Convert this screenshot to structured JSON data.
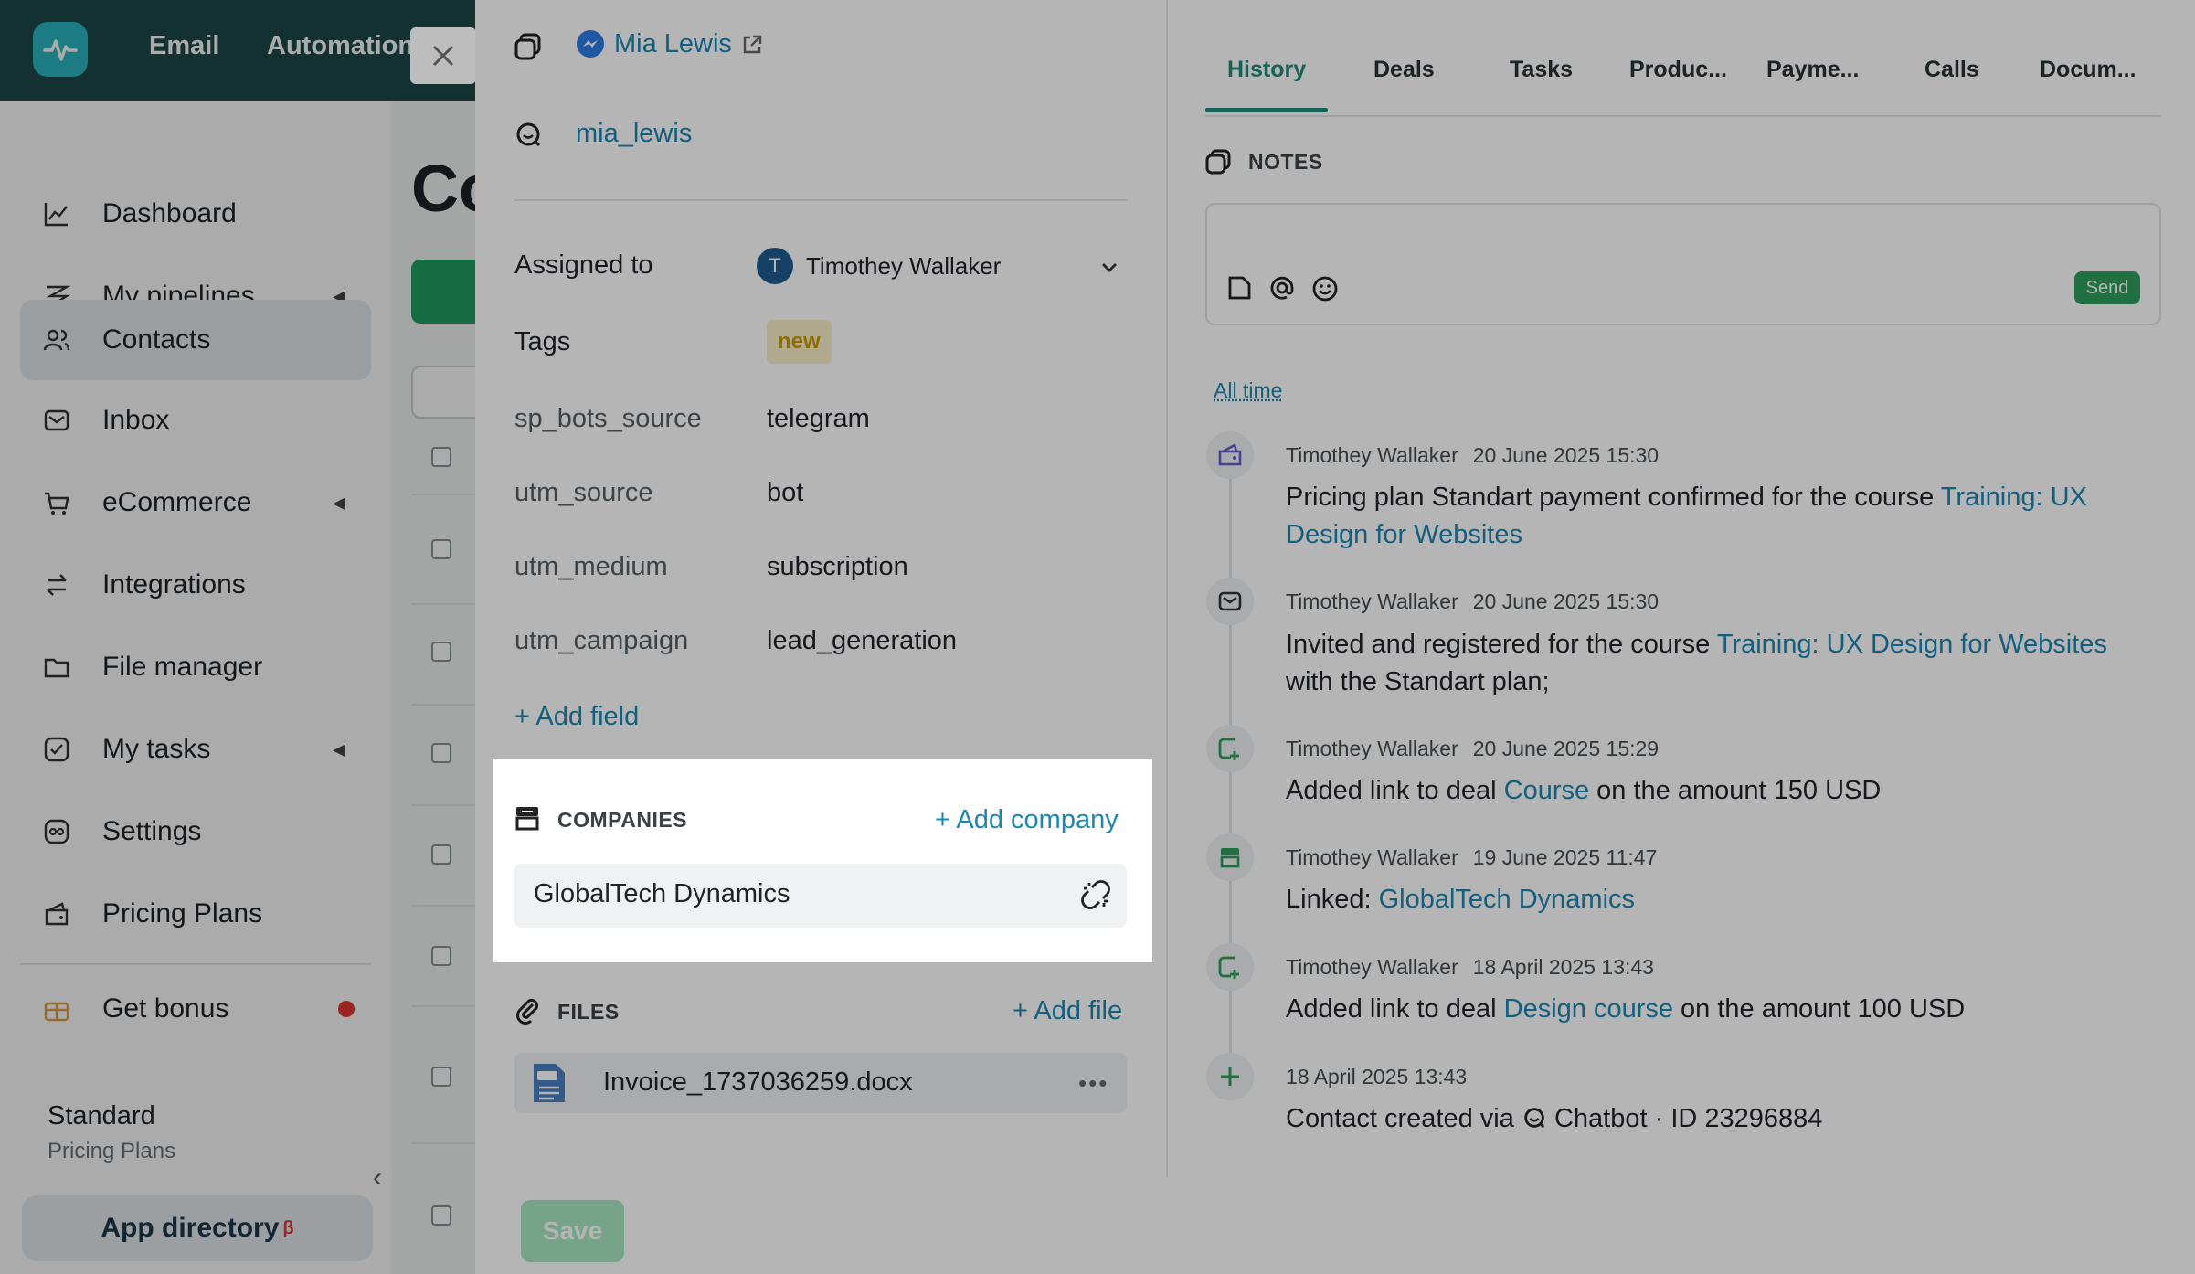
{
  "topbar": {
    "nav": [
      "Email",
      "Automation"
    ]
  },
  "sidebar": {
    "items": [
      {
        "label": "Dashboard",
        "icon": "chart-line-icon",
        "caret": false
      },
      {
        "label": "My pipelines",
        "icon": "pipelines-icon",
        "caret": true
      },
      {
        "label": "Contacts",
        "icon": "contacts-icon",
        "caret": false,
        "active": true
      },
      {
        "label": "Inbox",
        "icon": "inbox-icon",
        "caret": false
      },
      {
        "label": "eCommerce",
        "icon": "cart-icon",
        "caret": true
      },
      {
        "label": "Integrations",
        "icon": "arrows-icon",
        "caret": false
      },
      {
        "label": "File manager",
        "icon": "folder-icon",
        "caret": false
      },
      {
        "label": "My tasks",
        "icon": "check-icon",
        "caret": true
      },
      {
        "label": "Settings",
        "icon": "settings-icon",
        "caret": false
      },
      {
        "label": "Pricing Plans",
        "icon": "wallet-icon",
        "caret": false
      }
    ],
    "bonus_label": "Get bonus",
    "plan_name": "Standard",
    "plan_sub": "Pricing Plans",
    "app_directory": "App directory",
    "app_directory_badge": "β"
  },
  "main": {
    "title_fragment": "Co"
  },
  "contact": {
    "messenger_name": "Mia Lewis",
    "chatbot_username": "mia_lewis"
  },
  "fields": {
    "assigned_label": "Assigned to",
    "assigned_initial": "T",
    "assigned_name": "Timothey Wallaker",
    "tags_label": "Tags",
    "tag": "new",
    "custom": [
      {
        "label": "sp_bots_source",
        "value": "telegram"
      },
      {
        "label": "utm_source",
        "value": "bot"
      },
      {
        "label": "utm_medium",
        "value": "subscription"
      },
      {
        "label": "utm_campaign",
        "value": "lead_generation"
      }
    ],
    "add_field": "+ Add field"
  },
  "companies": {
    "title": "COMPANIES",
    "add": "+ Add company",
    "items": [
      "GlobalTech Dynamics"
    ]
  },
  "files": {
    "title": "FILES",
    "add": "+ Add file",
    "items": [
      "Invoice_1737036259.docx"
    ]
  },
  "save_label": "Save",
  "tabs": [
    "History",
    "Deals",
    "Tasks",
    "Produc...",
    "Payme...",
    "Calls",
    "Docum..."
  ],
  "notes": {
    "title": "NOTES",
    "send": "Send"
  },
  "filter": "All time",
  "history": [
    {
      "author": "Timothey Wallaker",
      "date": "20 June 2025 15:30",
      "pre": "Pricing plan Standart payment confirmed for the course ",
      "link": "Training: UX Design for Websites",
      "post": ""
    },
    {
      "author": "Timothey Wallaker",
      "date": "20 June 2025 15:30",
      "pre": "Invited and registered for the course ",
      "link": "Training: UX Design for Websites",
      "post": " with the Standart plan;"
    },
    {
      "author": "Timothey Wallaker",
      "date": "20 June 2025 15:29",
      "pre": "Added link to deal ",
      "link": "Course",
      "post": " on the amount 150 USD"
    },
    {
      "author": "Timothey Wallaker",
      "date": "19 June 2025 11:47",
      "pre": "Linked: ",
      "link": "GlobalTech Dynamics",
      "post": ""
    },
    {
      "author": "Timothey Wallaker",
      "date": "18 April 2025 13:43",
      "pre": "Added link to deal ",
      "link": "Design course",
      "post": " on the amount 100 USD"
    },
    {
      "author": "",
      "date": "18 April 2025 13:43",
      "pre": "Contact created via ",
      "link": "",
      "post": " Chatbot · ID 23296884"
    }
  ],
  "colors": {
    "accent": "#1e8a7a",
    "link": "#1b87b4",
    "send": "#2e9e5e",
    "tag_bg": "#fbf0c8",
    "tag_fg": "#c99a00"
  }
}
